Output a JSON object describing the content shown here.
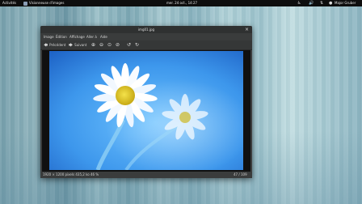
{
  "topbar": {
    "activities": "Activités",
    "app_name": "Visionneuse d'images",
    "clock": "mer. 24 oct., 14:27",
    "user": "Major Gruber"
  },
  "window": {
    "title": "img01.jpg",
    "menu": [
      "Image",
      "Édition",
      "Affichage",
      "Aller à",
      "Aide"
    ],
    "toolbar": {
      "previous": "Précédent",
      "next": "Suivant"
    },
    "status": {
      "dimensions": "1920 × 1200 pixels  435,2 ko",
      "zoom": "46 %",
      "position": "47 / 109"
    }
  }
}
